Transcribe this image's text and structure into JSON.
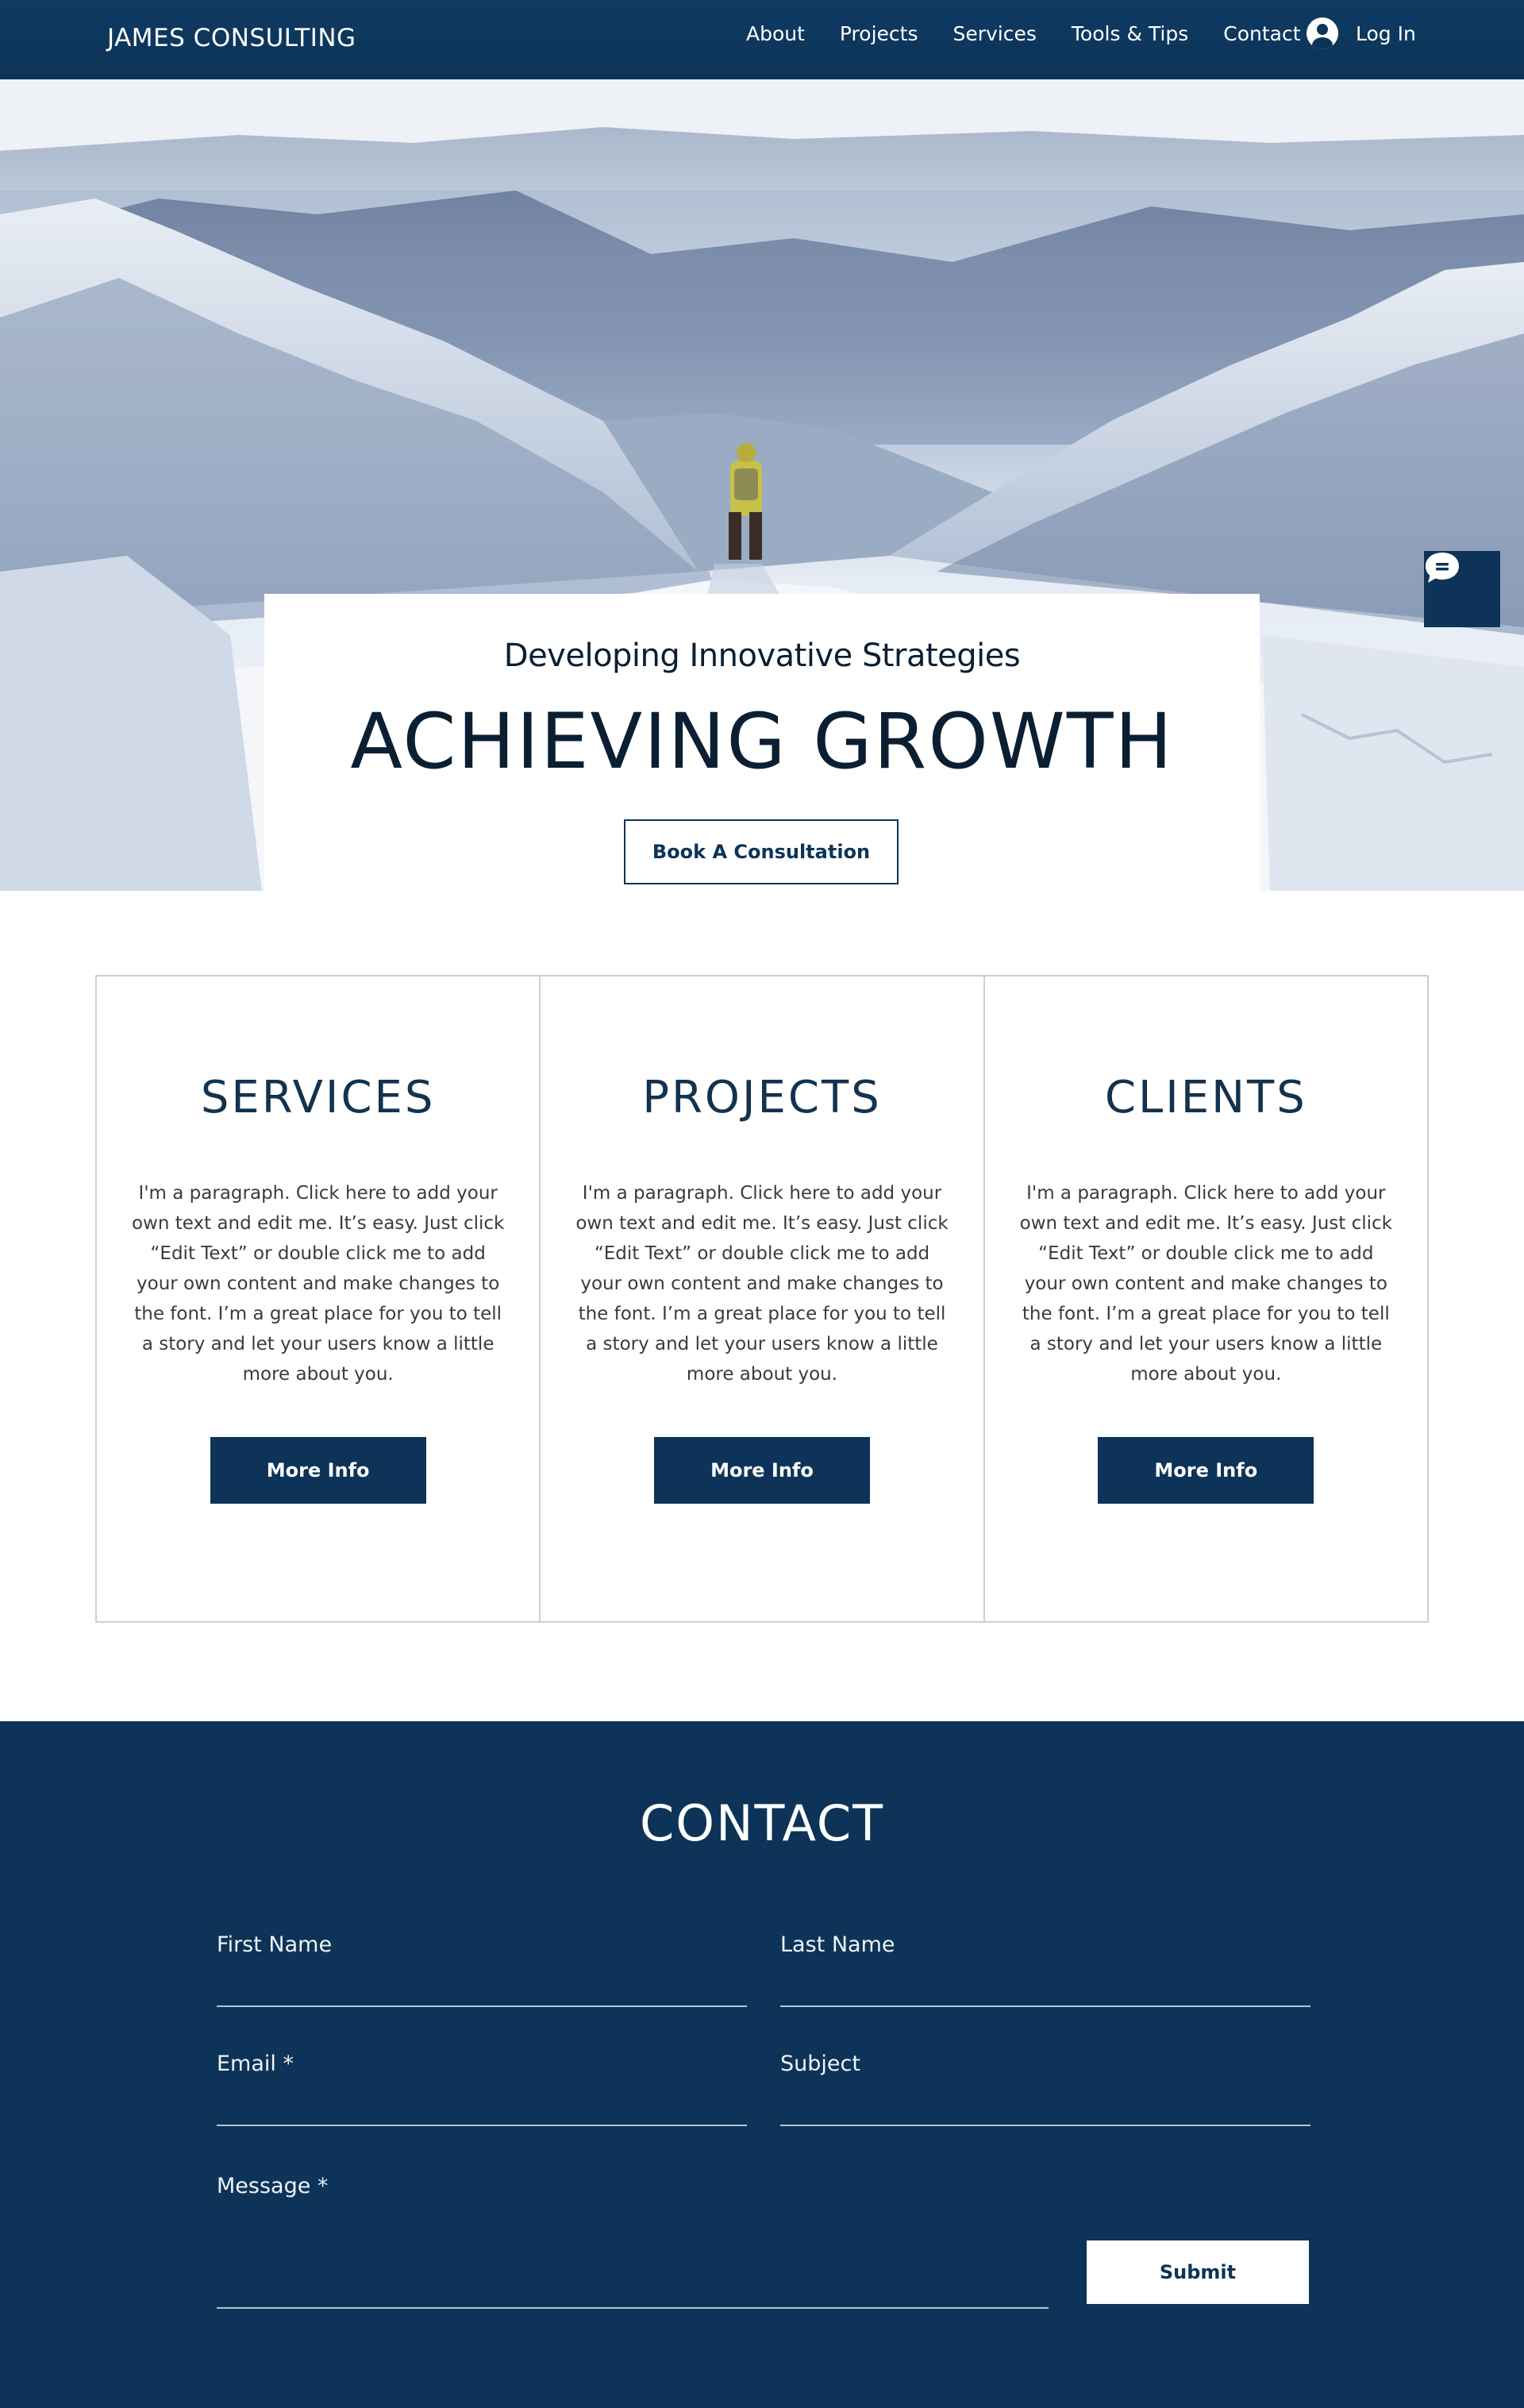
{
  "header": {
    "brand": "JAMES CONSULTING",
    "nav": [
      "About",
      "Projects",
      "Services",
      "Tools & Tips",
      "Contact"
    ],
    "login_label": "Log In",
    "login_icon": "user-avatar-icon"
  },
  "hero": {
    "subtitle": "Developing Innovative Strategies",
    "title": "ACHIEVING GROWTH",
    "cta_label": "Book A Consultation",
    "chat_icon": "chat-bubble-icon"
  },
  "features": [
    {
      "title": "SERVICES",
      "text": "I'm a paragraph. Click here to add your own text and edit me. It’s easy. Just click “Edit Text” or double click me to add your own content and make changes to the font. I’m a great place for you to tell a story and let your users know a little more about you.",
      "button": "More Info"
    },
    {
      "title": "PROJECTS",
      "text": "I'm a paragraph. Click here to add your own text and edit me. It’s easy. Just click “Edit Text” or double click me to add your own content and make changes to the font. I’m a great place for you to tell a story and let your users know a little more about you.",
      "button": "More Info"
    },
    {
      "title": "CLIENTS",
      "text": "I'm a paragraph. Click here to add your own text and edit me. It’s easy. Just click “Edit Text” or double click me to add your own content and make changes to the font. I’m a great place for you to tell a story and let your users know a little more about you.",
      "button": "More Info"
    }
  ],
  "contact": {
    "title": "CONTACT",
    "first_name_label": "First Name",
    "last_name_label": "Last Name",
    "email_label": "Email *",
    "subject_label": "Subject",
    "message_label": "Message *",
    "submit_label": "Submit"
  },
  "colors": {
    "brand_navy": "#0d3458",
    "text_dark": "#0b1f33",
    "border_gray": "#cdd0d4"
  }
}
